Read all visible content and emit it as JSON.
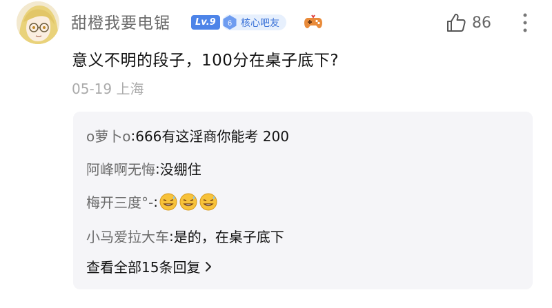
{
  "post": {
    "username": "甜橙我要电锯",
    "level_badge": "Lv.9",
    "member_badge_number": "6",
    "member_badge_label": "核心吧友",
    "like_count": "86",
    "content": "意义不明的段子，100分在桌子底下?",
    "date": "05-19",
    "location": "上海"
  },
  "replies": [
    {
      "author": "o萝卜o",
      "text": "666有这淫商你能考 200"
    },
    {
      "author": "阿峰啊无悔",
      "text": "没绷住"
    },
    {
      "author": "梅开三度°-",
      "text": ""
    },
    {
      "author": "小马爱拉大车",
      "text": "是的，在桌子底下"
    }
  ],
  "reply_separator": ":",
  "view_all_label": "查看全部15条回复",
  "icons": {
    "avatar": "anime-girl-avatar",
    "gamepad": "gamepad-icon",
    "like": "thumbs-up-icon",
    "more": "vertical-ellipsis-icon",
    "emoji": "sweating-smile-emoji",
    "chevron": "chevron-right-icon"
  },
  "colors": {
    "level_badge_bg": "#4d84e8",
    "member_badge_bg": "#e7f0fd",
    "member_badge_text": "#3c73d8",
    "reply_box_bg": "#f5f5f8",
    "author_text": "#6b6b6b",
    "meta_text": "#aaaaaa"
  }
}
